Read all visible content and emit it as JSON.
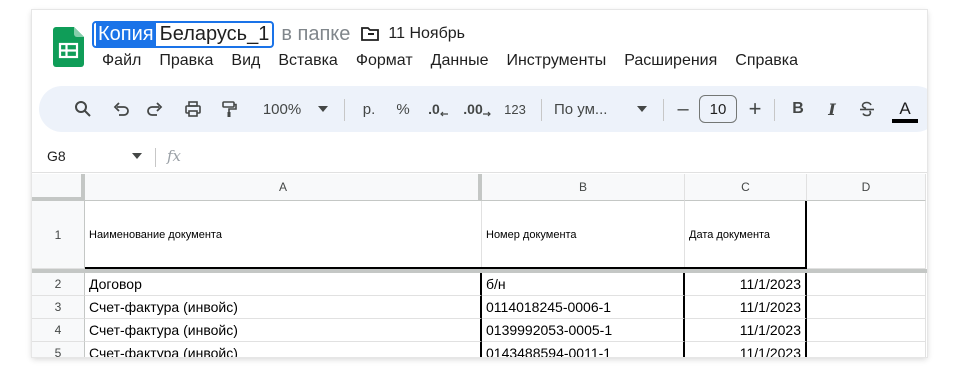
{
  "header": {
    "title_selected": "Копия",
    "title_rest": "Беларусь_1",
    "folder_prefix": "в папке",
    "folder_name": "11 Ноябрь"
  },
  "menu": [
    "Файл",
    "Правка",
    "Вид",
    "Вставка",
    "Формат",
    "Данные",
    "Инструменты",
    "Расширения",
    "Справка"
  ],
  "toolbar": {
    "zoom": "100%",
    "currency": "р.",
    "percent": "%",
    "dec_decrease": ".0",
    "dec_increase": ".00",
    "number_format": "123",
    "font": "По ум...",
    "font_size": "10",
    "minus": "–",
    "plus": "+",
    "bold": "B",
    "italic": "I",
    "text_color": "A"
  },
  "formula_bar": {
    "cell_ref": "G8",
    "fx": "fx"
  },
  "sheet": {
    "columns": [
      "A",
      "B",
      "C",
      "D"
    ],
    "rows": [
      {
        "num": "1",
        "a": "Наименование документа",
        "b": "Номер документа",
        "c": "Дата документа",
        "d": ""
      },
      {
        "num": "2",
        "a": "Договор",
        "b": "б/н",
        "c": "11/1/2023",
        "d": ""
      },
      {
        "num": "3",
        "a": "Счет-фактура (инвойс)",
        "b": "0114018245-0006-1",
        "c": "11/1/2023",
        "d": ""
      },
      {
        "num": "4",
        "a": "Счет-фактура (инвойс)",
        "b": "0139992053-0005-1",
        "c": "11/1/2023",
        "d": ""
      },
      {
        "num": "5",
        "a": "Счет-фактура (инвойс)",
        "b": "0143488594-0011-1",
        "c": "11/1/2023",
        "d": ""
      }
    ]
  },
  "colors": {
    "accent": "#1a73e8",
    "sheets_green": "#0f9d58",
    "toolbar_bg": "#edf2fa"
  }
}
